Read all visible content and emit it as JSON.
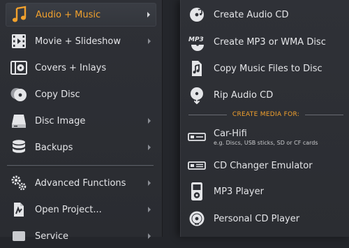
{
  "left_menu": {
    "items": [
      {
        "label": "Audio + Music",
        "icon": "music-note-icon",
        "has_submenu": true,
        "active": true
      },
      {
        "label": "Movie + Slideshow",
        "icon": "film-strip-icon",
        "has_submenu": true
      },
      {
        "label": "Covers + Inlays",
        "icon": "cover-inlay-icon",
        "has_submenu": false
      },
      {
        "label": "Copy Disc",
        "icon": "copy-disc-icon",
        "has_submenu": false
      },
      {
        "label": "Disc Image",
        "icon": "disc-image-icon",
        "has_submenu": true
      },
      {
        "label": "Backups",
        "icon": "database-icon",
        "has_submenu": true
      },
      {
        "label": "Advanced Functions",
        "icon": "gears-icon",
        "has_submenu": true
      },
      {
        "label": "Open Project...",
        "icon": "open-project-icon",
        "has_submenu": true
      },
      {
        "label": "Service",
        "icon": "service-icon",
        "has_submenu": true
      }
    ]
  },
  "submenu": {
    "items": [
      {
        "label": "Create Audio CD",
        "icon": "audio-cd-icon"
      },
      {
        "label": "Create MP3 or WMA Disc",
        "icon": "mp3-disc-icon"
      },
      {
        "label": "Copy Music Files to Disc",
        "icon": "music-file-icon"
      },
      {
        "label": "Rip Audio CD",
        "icon": "rip-cd-icon"
      }
    ],
    "section_title": "CREATE MEDIA FOR:",
    "media_items": [
      {
        "label": "Car-Hifi",
        "hint": "e.g. Discs, USB sticks, SD or CF cards",
        "icon": "car-hifi-icon"
      },
      {
        "label": "CD Changer Emulator",
        "icon": "cd-changer-icon"
      },
      {
        "label": "MP3 Player",
        "icon": "mp3-player-icon"
      },
      {
        "label": "Personal CD Player",
        "icon": "cd-player-icon"
      }
    ]
  },
  "colors": {
    "accent": "#f2a12d",
    "background": "#2b2d32",
    "text": "#e4e5e8"
  }
}
